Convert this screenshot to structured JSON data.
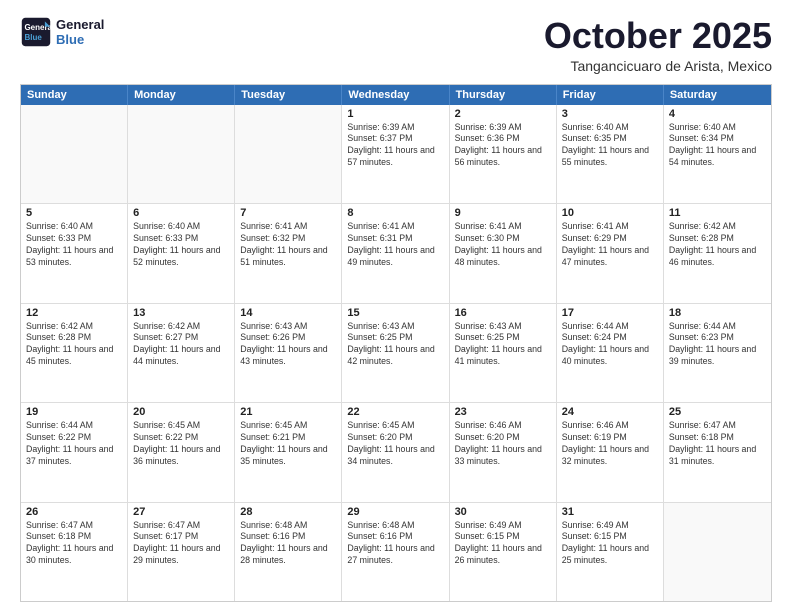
{
  "logo": {
    "line1": "General",
    "line2": "Blue"
  },
  "header": {
    "month": "October 2025",
    "location": "Tangancicuaro de Arista, Mexico"
  },
  "days": [
    "Sunday",
    "Monday",
    "Tuesday",
    "Wednesday",
    "Thursday",
    "Friday",
    "Saturday"
  ],
  "rows": [
    [
      {
        "day": "",
        "text": ""
      },
      {
        "day": "",
        "text": ""
      },
      {
        "day": "",
        "text": ""
      },
      {
        "day": "1",
        "text": "Sunrise: 6:39 AM\nSunset: 6:37 PM\nDaylight: 11 hours and 57 minutes."
      },
      {
        "day": "2",
        "text": "Sunrise: 6:39 AM\nSunset: 6:36 PM\nDaylight: 11 hours and 56 minutes."
      },
      {
        "day": "3",
        "text": "Sunrise: 6:40 AM\nSunset: 6:35 PM\nDaylight: 11 hours and 55 minutes."
      },
      {
        "day": "4",
        "text": "Sunrise: 6:40 AM\nSunset: 6:34 PM\nDaylight: 11 hours and 54 minutes."
      }
    ],
    [
      {
        "day": "5",
        "text": "Sunrise: 6:40 AM\nSunset: 6:33 PM\nDaylight: 11 hours and 53 minutes."
      },
      {
        "day": "6",
        "text": "Sunrise: 6:40 AM\nSunset: 6:33 PM\nDaylight: 11 hours and 52 minutes."
      },
      {
        "day": "7",
        "text": "Sunrise: 6:41 AM\nSunset: 6:32 PM\nDaylight: 11 hours and 51 minutes."
      },
      {
        "day": "8",
        "text": "Sunrise: 6:41 AM\nSunset: 6:31 PM\nDaylight: 11 hours and 49 minutes."
      },
      {
        "day": "9",
        "text": "Sunrise: 6:41 AM\nSunset: 6:30 PM\nDaylight: 11 hours and 48 minutes."
      },
      {
        "day": "10",
        "text": "Sunrise: 6:41 AM\nSunset: 6:29 PM\nDaylight: 11 hours and 47 minutes."
      },
      {
        "day": "11",
        "text": "Sunrise: 6:42 AM\nSunset: 6:28 PM\nDaylight: 11 hours and 46 minutes."
      }
    ],
    [
      {
        "day": "12",
        "text": "Sunrise: 6:42 AM\nSunset: 6:28 PM\nDaylight: 11 hours and 45 minutes."
      },
      {
        "day": "13",
        "text": "Sunrise: 6:42 AM\nSunset: 6:27 PM\nDaylight: 11 hours and 44 minutes."
      },
      {
        "day": "14",
        "text": "Sunrise: 6:43 AM\nSunset: 6:26 PM\nDaylight: 11 hours and 43 minutes."
      },
      {
        "day": "15",
        "text": "Sunrise: 6:43 AM\nSunset: 6:25 PM\nDaylight: 11 hours and 42 minutes."
      },
      {
        "day": "16",
        "text": "Sunrise: 6:43 AM\nSunset: 6:25 PM\nDaylight: 11 hours and 41 minutes."
      },
      {
        "day": "17",
        "text": "Sunrise: 6:44 AM\nSunset: 6:24 PM\nDaylight: 11 hours and 40 minutes."
      },
      {
        "day": "18",
        "text": "Sunrise: 6:44 AM\nSunset: 6:23 PM\nDaylight: 11 hours and 39 minutes."
      }
    ],
    [
      {
        "day": "19",
        "text": "Sunrise: 6:44 AM\nSunset: 6:22 PM\nDaylight: 11 hours and 37 minutes."
      },
      {
        "day": "20",
        "text": "Sunrise: 6:45 AM\nSunset: 6:22 PM\nDaylight: 11 hours and 36 minutes."
      },
      {
        "day": "21",
        "text": "Sunrise: 6:45 AM\nSunset: 6:21 PM\nDaylight: 11 hours and 35 minutes."
      },
      {
        "day": "22",
        "text": "Sunrise: 6:45 AM\nSunset: 6:20 PM\nDaylight: 11 hours and 34 minutes."
      },
      {
        "day": "23",
        "text": "Sunrise: 6:46 AM\nSunset: 6:20 PM\nDaylight: 11 hours and 33 minutes."
      },
      {
        "day": "24",
        "text": "Sunrise: 6:46 AM\nSunset: 6:19 PM\nDaylight: 11 hours and 32 minutes."
      },
      {
        "day": "25",
        "text": "Sunrise: 6:47 AM\nSunset: 6:18 PM\nDaylight: 11 hours and 31 minutes."
      }
    ],
    [
      {
        "day": "26",
        "text": "Sunrise: 6:47 AM\nSunset: 6:18 PM\nDaylight: 11 hours and 30 minutes."
      },
      {
        "day": "27",
        "text": "Sunrise: 6:47 AM\nSunset: 6:17 PM\nDaylight: 11 hours and 29 minutes."
      },
      {
        "day": "28",
        "text": "Sunrise: 6:48 AM\nSunset: 6:16 PM\nDaylight: 11 hours and 28 minutes."
      },
      {
        "day": "29",
        "text": "Sunrise: 6:48 AM\nSunset: 6:16 PM\nDaylight: 11 hours and 27 minutes."
      },
      {
        "day": "30",
        "text": "Sunrise: 6:49 AM\nSunset: 6:15 PM\nDaylight: 11 hours and 26 minutes."
      },
      {
        "day": "31",
        "text": "Sunrise: 6:49 AM\nSunset: 6:15 PM\nDaylight: 11 hours and 25 minutes."
      },
      {
        "day": "",
        "text": ""
      }
    ]
  ]
}
